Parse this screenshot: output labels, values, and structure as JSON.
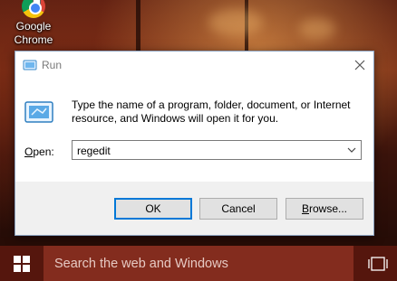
{
  "desktop": {
    "icons": [
      {
        "label_line1": "Google",
        "label_line2": "Chrome",
        "icon": "chrome-icon"
      }
    ]
  },
  "dialog": {
    "title": "Run",
    "description_line1": "Type the name of a program, folder, document, or Internet",
    "description_line2": "resource, and Windows will open it for you.",
    "open_label_prefix": "O",
    "open_label_rest": "pen:",
    "open_value": "regedit",
    "buttons": {
      "ok": "OK",
      "cancel": "Cancel",
      "browse_prefix": "B",
      "browse_rest": "rowse..."
    },
    "icons": [
      "run-icon",
      "close-icon",
      "chevron-down-icon"
    ]
  },
  "taskbar": {
    "search_placeholder": "Search the web and Windows",
    "icons": [
      "windows-start-icon",
      "task-view-icon"
    ]
  },
  "colors": {
    "accent": "#0078d7",
    "taskbar": "#5a180e",
    "search_box": "#8c3022",
    "dialog_footer": "#f0f0f0"
  }
}
